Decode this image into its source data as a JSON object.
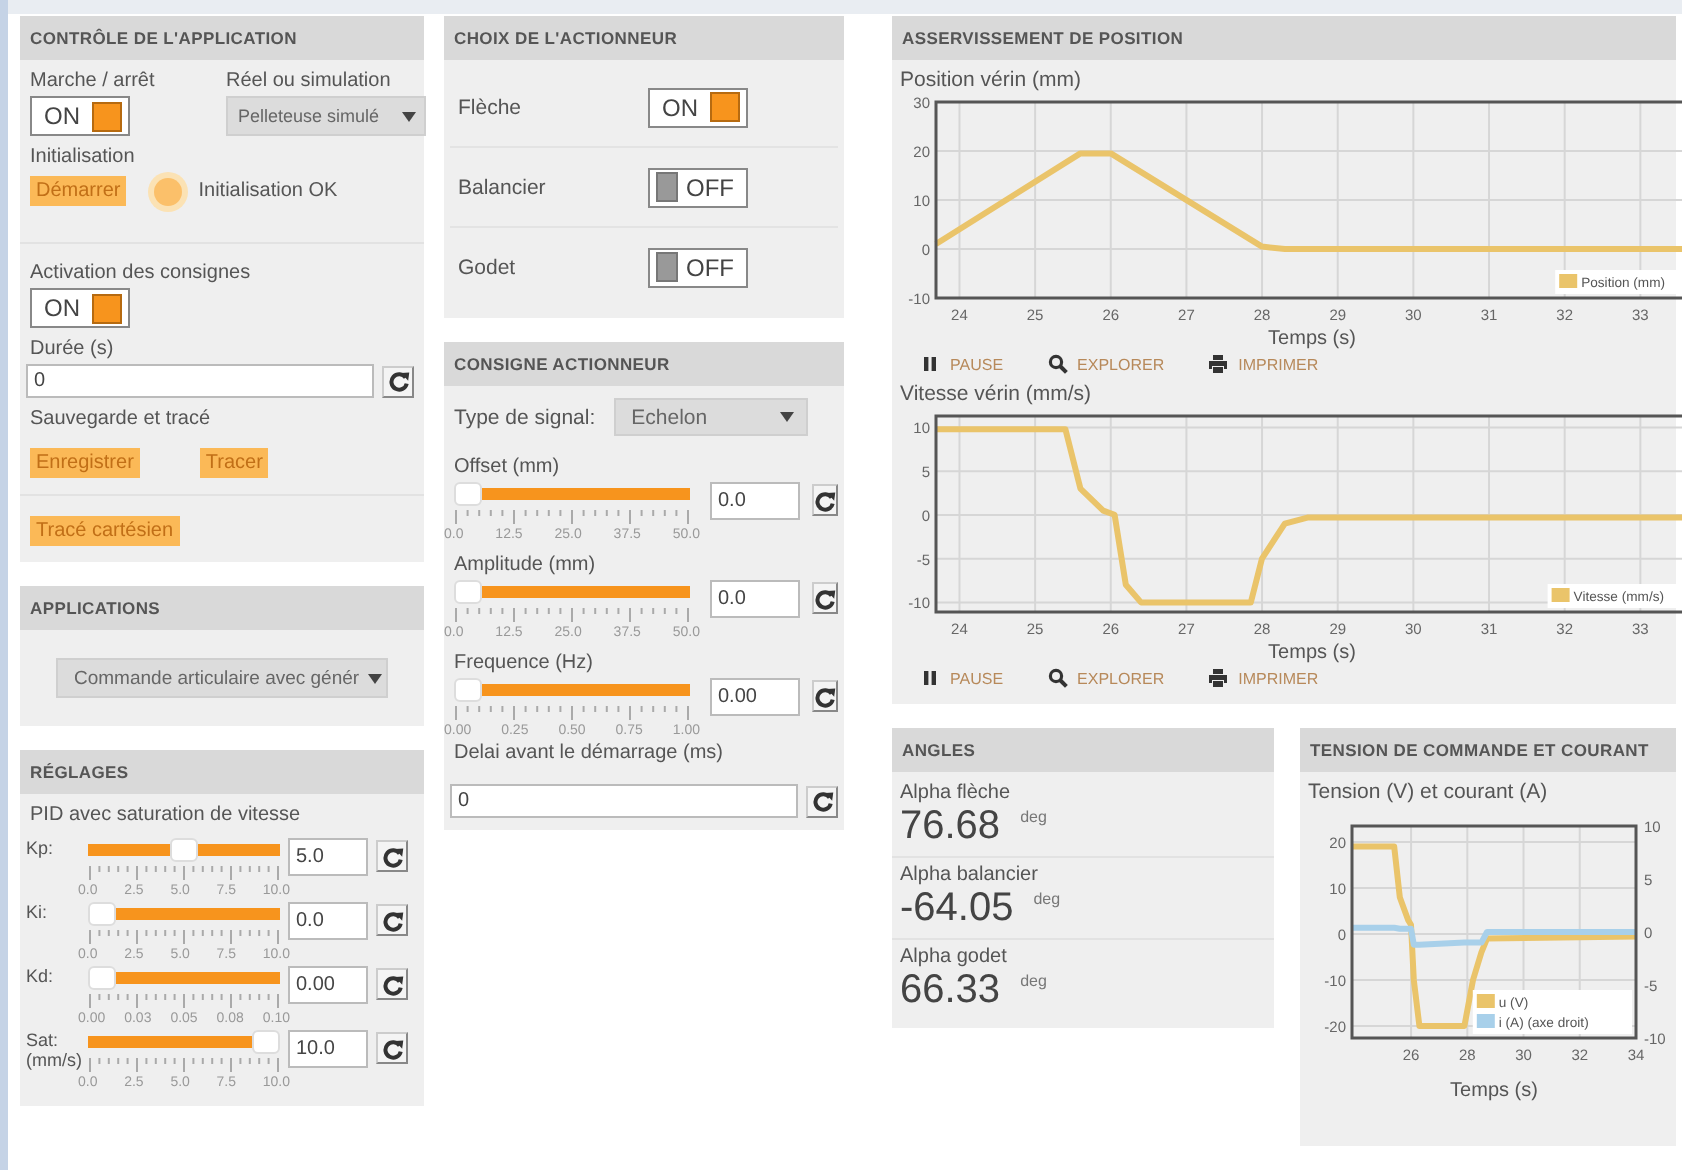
{
  "control": {
    "title": "CONTRÔLE DE L'APPLICATION",
    "power": {
      "label": "Marche / arrêt",
      "on": true,
      "text": "ON"
    },
    "mode": {
      "label": "Réel ou simulation",
      "value": "Pelleteuse simulé"
    },
    "init": {
      "label": "Initialisation",
      "button": "Démarrer",
      "lit": true,
      "status": "Initialisation OK"
    },
    "setpoints": {
      "label": "Activation des consignes",
      "on": true,
      "text": "ON"
    },
    "duration": {
      "label": "Durée (s)",
      "value": "0"
    },
    "save": {
      "label": "Sauvegarde et tracé",
      "buttons": [
        "Enregistrer",
        "Tracer"
      ]
    },
    "cartesian": {
      "button": "Tracé cartésien"
    }
  },
  "applications": {
    "title": "APPLICATIONS",
    "value": "Commande articulaire avec génér"
  },
  "tuning": {
    "title": "RÉGLAGES",
    "subtitle": "PID avec saturation de vitesse",
    "sliders": [
      {
        "label": "Kp:",
        "level": 0.5,
        "scale": [
          "0.0",
          "2.5",
          "5.0",
          "7.5",
          "10.0"
        ],
        "value": "5.0"
      },
      {
        "label": "Ki:",
        "level": 0,
        "scale": [
          "0.0",
          "2.5",
          "5.0",
          "7.5",
          "10.0"
        ],
        "value": "0.0"
      },
      {
        "label": "Kd:",
        "level": 0,
        "scale": [
          "0.00",
          "0.03",
          "0.05",
          "0.08",
          "0.10"
        ],
        "value": "0.00"
      },
      {
        "label": "Sat: (mm/s)",
        "level": 1,
        "scale": [
          "0.0",
          "2.5",
          "5.0",
          "7.5",
          "10.0"
        ],
        "value": "10.0"
      }
    ]
  },
  "actuator_choice": {
    "title": "CHOIX DE L'ACTIONNEUR",
    "rows": [
      {
        "label": "Flèche",
        "on": true,
        "text": "ON"
      },
      {
        "label": "Balancier",
        "on": false,
        "text": "OFF"
      },
      {
        "label": "Godet",
        "on": false,
        "text": "OFF"
      }
    ]
  },
  "setpoint": {
    "title": "CONSIGNE ACTIONNEUR",
    "signal": {
      "label": "Type de signal:",
      "value": "Echelon"
    },
    "sliders": [
      {
        "label": "Offset (mm)",
        "level": 0,
        "scale": [
          "0.0",
          "12.5",
          "25.0",
          "37.5",
          "50.0"
        ],
        "value": "0.0"
      },
      {
        "label": "Amplitude (mm)",
        "level": 0,
        "scale": [
          "0.0",
          "12.5",
          "25.0",
          "37.5",
          "50.0"
        ],
        "value": "0.0"
      },
      {
        "label": "Frequence (Hz)",
        "level": 0,
        "scale": [
          "0.00",
          "0.25",
          "0.50",
          "0.75",
          "1.00"
        ],
        "value": "0.00"
      }
    ],
    "delay": {
      "label": "Delai avant le démarrage (ms)",
      "value": "0"
    }
  },
  "position_control": {
    "title": "ASSERVISSEMENT DE POSITION",
    "charts": [
      {
        "chart_data": {
          "type": "line",
          "grid": true,
          "legend": true,
          "title": "Position vérin (mm)",
          "xlabel": "Temps (s)",
          "x": [
            23.69,
            25.6,
            26.0,
            28.0,
            28.3,
            33.63
          ],
          "xlim": [
            23.69,
            33.63
          ],
          "ylim": [
            -10,
            30
          ],
          "xticks": [
            24,
            25,
            26,
            27,
            28,
            29,
            30,
            31,
            32,
            33
          ],
          "yticks": [
            -10,
            0,
            10,
            20,
            30
          ],
          "series": [
            {
              "name": "Position (mm)",
              "color": "#eac46a",
              "values": [
                1,
                19.5,
                19.5,
                0.5,
                0,
                0
              ]
            }
          ]
        },
        "toolbar": [
          {
            "kind": "pause",
            "label": "PAUSE"
          },
          {
            "kind": "search",
            "label": "EXPLORER"
          },
          {
            "kind": "print",
            "label": "IMPRIMER"
          }
        ]
      },
      {
        "chart_data": {
          "type": "line",
          "grid": true,
          "legend": true,
          "title": "Vitesse vérin (mm/s)",
          "xlabel": "Temps (s)",
          "x": [
            23.69,
            25.4,
            25.6,
            25.9,
            26.05,
            26.2,
            26.4,
            27.85,
            28.0,
            28.3,
            28.6,
            33.63
          ],
          "xlim": [
            23.69,
            33.63
          ],
          "ylim": [
            -11.1,
            11.3
          ],
          "xticks": [
            24,
            25,
            26,
            27,
            28,
            29,
            30,
            31,
            32,
            33
          ],
          "yticks": [
            -10,
            -5,
            0,
            5,
            10
          ],
          "series": [
            {
              "name": "Vitesse (mm/s)",
              "color": "#eac46a",
              "values": [
                9.8,
                9.8,
                3,
                0.5,
                0,
                -8,
                -10,
                -10,
                -5,
                -1,
                -0.3,
                -0.3
              ]
            }
          ]
        },
        "toolbar": [
          {
            "kind": "pause",
            "label": "PAUSE"
          },
          {
            "kind": "search",
            "label": "EXPLORER"
          },
          {
            "kind": "print",
            "label": "IMPRIMER"
          }
        ]
      }
    ]
  },
  "angles": {
    "title": "ANGLES",
    "items": [
      {
        "label": "Alpha flèche",
        "value": "76.68",
        "unit": "deg"
      },
      {
        "label": "Alpha balancier",
        "value": "-64.05",
        "unit": "deg"
      },
      {
        "label": "Alpha godet",
        "value": "66.33",
        "unit": "deg"
      }
    ]
  },
  "voltage": {
    "title": "TENSION DE COMMANDE ET COURANT",
    "chart_data": {
      "type": "line",
      "grid": true,
      "legend": true,
      "title": "Tension (V) et courant (A)",
      "xlabel": "Temps (s)",
      "x": [
        23.9,
        25.4,
        25.6,
        25.9,
        26.0,
        26.1,
        26.3,
        27.9,
        28.2,
        28.5,
        28.7,
        34
      ],
      "xlim": [
        23.9,
        34
      ],
      "ylim": [
        -22.6,
        23.5
      ],
      "y2lim": [
        -10,
        10
      ],
      "xticks": [
        26,
        28,
        30,
        32,
        34
      ],
      "yticks": [
        -20,
        -10,
        0,
        10,
        20
      ],
      "y2ticks": [
        -10,
        -5,
        0,
        5,
        10
      ],
      "series": [
        {
          "name": "u (V)",
          "color": "#eac46a",
          "values": [
            19,
            19,
            8,
            3,
            2,
            -10,
            -20,
            -20,
            -10,
            -4,
            -1,
            -0.5
          ]
        },
        {
          "name": "i (A) (axe droit)",
          "color": "#a8d0ea",
          "axis": "y2",
          "values": [
            0.4,
            0.4,
            0.3,
            0.3,
            0.3,
            -1.2,
            -1.2,
            -1,
            -1,
            -1,
            0,
            0
          ]
        }
      ]
    }
  }
}
